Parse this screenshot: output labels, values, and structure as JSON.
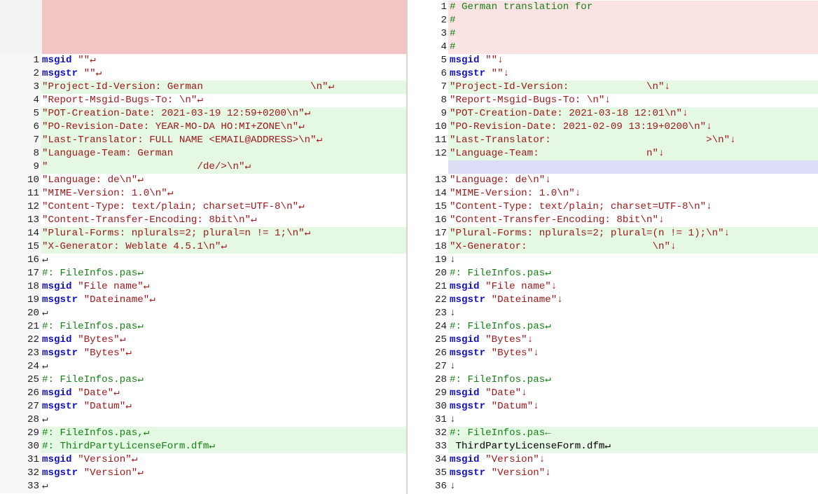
{
  "left": {
    "lines": [
      {
        "n": "1",
        "t": "msgid \"\"↵",
        "k": "kw",
        "c": ""
      },
      {
        "n": "2",
        "t": "msgstr \"\"↵",
        "k": "kw",
        "c": ""
      },
      {
        "n": "3",
        "t": "\"Project-Id-Version: German                  \\n\"↵",
        "k": "str",
        "c": "g"
      },
      {
        "n": "4",
        "t": "\"Report-Msgid-Bugs-To: \\n\"↵",
        "k": "str",
        "c": ""
      },
      {
        "n": "5",
        "t": "\"POT-Creation-Date: 2021-03-19 12:59+0200\\n\"↵",
        "k": "str",
        "c": "g"
      },
      {
        "n": "6",
        "t": "\"PO-Revision-Date: YEAR-MO-DA HO:MI+ZONE\\n\"↵",
        "k": "str",
        "c": "g"
      },
      {
        "n": "7",
        "t": "\"Last-Translator: FULL NAME <EMAIL@ADDRESS>\\n\"↵",
        "k": "str",
        "c": "g"
      },
      {
        "n": "8",
        "t": "\"Language-Team: German",
        "k": "str",
        "c": "g"
      },
      {
        "n": "9",
        "t": "\"                         /de/>\\n\"↵",
        "k": "str",
        "c": "g"
      },
      {
        "n": "10",
        "t": "\"Language: de\\n\"↵",
        "k": "str",
        "c": ""
      },
      {
        "n": "11",
        "t": "\"MIME-Version: 1.0\\n\"↵",
        "k": "str",
        "c": ""
      },
      {
        "n": "12",
        "t": "\"Content-Type: text/plain; charset=UTF-8\\n\"↵",
        "k": "str",
        "c": ""
      },
      {
        "n": "13",
        "t": "\"Content-Transfer-Encoding: 8bit\\n\"↵",
        "k": "str",
        "c": ""
      },
      {
        "n": "14",
        "t": "\"Plural-Forms: nplurals=2; plural=n != 1;\\n\"↵",
        "k": "str",
        "c": "g"
      },
      {
        "n": "15",
        "t": "\"X-Generator: Weblate 4.5.1\\n\"↵",
        "k": "str",
        "c": "g"
      },
      {
        "n": "16",
        "t": "↵",
        "k": "eol",
        "c": ""
      },
      {
        "n": "17",
        "t": "#: FileInfos.pas↵",
        "k": "cm",
        "c": ""
      },
      {
        "n": "18",
        "t": "msgid \"File name\"↵",
        "k": "kw",
        "c": ""
      },
      {
        "n": "19",
        "t": "msgstr \"Dateiname\"↵",
        "k": "kw",
        "c": ""
      },
      {
        "n": "20",
        "t": "↵",
        "k": "eol",
        "c": ""
      },
      {
        "n": "21",
        "t": "#: FileInfos.pas↵",
        "k": "cm",
        "c": ""
      },
      {
        "n": "22",
        "t": "msgid \"Bytes\"↵",
        "k": "kw",
        "c": ""
      },
      {
        "n": "23",
        "t": "msgstr \"Bytes\"↵",
        "k": "kw",
        "c": ""
      },
      {
        "n": "24",
        "t": "↵",
        "k": "eol",
        "c": ""
      },
      {
        "n": "25",
        "t": "#: FileInfos.pas↵",
        "k": "cm",
        "c": ""
      },
      {
        "n": "26",
        "t": "msgid \"Date\"↵",
        "k": "kw",
        "c": ""
      },
      {
        "n": "27",
        "t": "msgstr \"Datum\"↵",
        "k": "kw",
        "c": ""
      },
      {
        "n": "28",
        "t": "↵",
        "k": "eol",
        "c": ""
      },
      {
        "n": "29",
        "t": "#: FileInfos.pas,↵",
        "k": "cm",
        "c": "g"
      },
      {
        "n": "30",
        "t": "#: ThirdPartyLicenseForm.dfm↵",
        "k": "cm",
        "c": "g"
      },
      {
        "n": "31",
        "t": "msgid \"Version\"↵",
        "k": "kw",
        "c": ""
      },
      {
        "n": "32",
        "t": "msgstr \"Version\"↵",
        "k": "kw",
        "c": ""
      },
      {
        "n": "33",
        "t": "↵",
        "k": "eol",
        "c": ""
      }
    ]
  },
  "right": {
    "lines": [
      {
        "n": "1",
        "t": "# German translation for",
        "k": "cm",
        "c": "r"
      },
      {
        "n": "2",
        "t": "#",
        "k": "cm",
        "c": "r"
      },
      {
        "n": "3",
        "t": "#",
        "k": "cm",
        "c": "r"
      },
      {
        "n": "4",
        "t": "#",
        "k": "cm",
        "c": "r"
      },
      {
        "n": "5",
        "t": "msgid \"\"↓",
        "k": "kw",
        "c": ""
      },
      {
        "n": "6",
        "t": "msgstr \"\"↓",
        "k": "kw",
        "c": ""
      },
      {
        "n": "7",
        "t": "\"Project-Id-Version:             \\n\"↓",
        "k": "str",
        "c": "g"
      },
      {
        "n": "8",
        "t": "\"Report-Msgid-Bugs-To: \\n\"↓",
        "k": "str",
        "c": ""
      },
      {
        "n": "9",
        "t": "\"POT-Creation-Date: 2021-03-18 12:01\\n\"↓",
        "k": "str",
        "c": "g"
      },
      {
        "n": "10",
        "t": "\"PO-Revision-Date: 2021-02-09 13:19+0200\\n\"↓",
        "k": "str",
        "c": "g"
      },
      {
        "n": "11",
        "t": "\"Last-Translator:                          >\\n\"↓",
        "k": "str",
        "c": "g"
      },
      {
        "n": "12",
        "t": "\"Language-Team:                  n\"↓",
        "k": "str",
        "c": "g"
      },
      {
        "n": "",
        "t": "",
        "k": "str",
        "c": "b"
      },
      {
        "n": "13",
        "t": "\"Language: de\\n\"↓",
        "k": "str",
        "c": ""
      },
      {
        "n": "14",
        "t": "\"MIME-Version: 1.0\\n\"↓",
        "k": "str",
        "c": ""
      },
      {
        "n": "15",
        "t": "\"Content-Type: text/plain; charset=UTF-8\\n\"↓",
        "k": "str",
        "c": ""
      },
      {
        "n": "16",
        "t": "\"Content-Transfer-Encoding: 8bit\\n\"↓",
        "k": "str",
        "c": ""
      },
      {
        "n": "17",
        "t": "\"Plural-Forms: nplurals=2; plural=(n != 1);\\n\"↓",
        "k": "str",
        "c": "g"
      },
      {
        "n": "18",
        "t": "\"X-Generator:                     \\n\"↓",
        "k": "str",
        "c": "g"
      },
      {
        "n": "19",
        "t": "↓",
        "k": "eol",
        "c": ""
      },
      {
        "n": "20",
        "t": "#: FileInfos.pas↵",
        "k": "cm",
        "c": ""
      },
      {
        "n": "21",
        "t": "msgid \"File name\"↓",
        "k": "kw",
        "c": ""
      },
      {
        "n": "22",
        "t": "msgstr \"Dateiname\"↓",
        "k": "kw",
        "c": ""
      },
      {
        "n": "23",
        "t": "↓",
        "k": "eol",
        "c": ""
      },
      {
        "n": "24",
        "t": "#: FileInfos.pas↵",
        "k": "cm",
        "c": ""
      },
      {
        "n": "25",
        "t": "msgid \"Bytes\"↓",
        "k": "kw",
        "c": ""
      },
      {
        "n": "26",
        "t": "msgstr \"Bytes\"↓",
        "k": "kw",
        "c": ""
      },
      {
        "n": "27",
        "t": "↓",
        "k": "eol",
        "c": ""
      },
      {
        "n": "28",
        "t": "#: FileInfos.pas↵",
        "k": "cm",
        "c": ""
      },
      {
        "n": "29",
        "t": "msgid \"Date\"↓",
        "k": "kw",
        "c": ""
      },
      {
        "n": "30",
        "t": "msgstr \"Datum\"↓",
        "k": "kw",
        "c": ""
      },
      {
        "n": "31",
        "t": "↓",
        "k": "eol",
        "c": ""
      },
      {
        "n": "32",
        "t": "#: FileInfos.pas←",
        "k": "cm",
        "c": "g"
      },
      {
        "n": "33",
        "t": " ThirdPartyLicenseForm.dfm↵",
        "k": "plain",
        "c": "g"
      },
      {
        "n": "34",
        "t": "msgid \"Version\"↓",
        "k": "kw",
        "c": ""
      },
      {
        "n": "35",
        "t": "msgstr \"Version\"↓",
        "k": "kw",
        "c": ""
      },
      {
        "n": "36",
        "t": "↓",
        "k": "eol",
        "c": ""
      }
    ]
  }
}
